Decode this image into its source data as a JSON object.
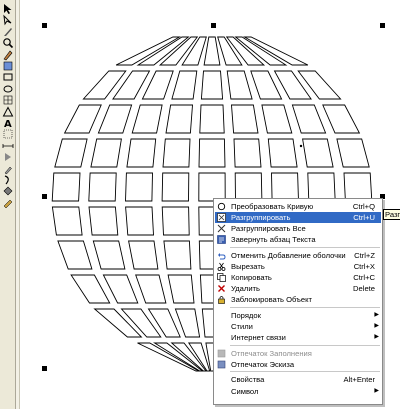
{
  "toolbox": {
    "tools": [
      "pick-tool",
      "shape-tool",
      "knife-tool",
      "zoom-tool",
      "freehand-tool",
      "smart-fill-tool",
      "rectangle-tool",
      "ellipse-tool",
      "polygon-tool",
      "basic-shapes-tool",
      "text-tool",
      "table-tool",
      "dimension-tool",
      "interactive-blend-tool",
      "eyedropper-tool",
      "outline-tool",
      "fill-tool",
      "interactive-fill-tool"
    ]
  },
  "drawing": {
    "object": "envelope-distorted-grid",
    "grid_rows": 10,
    "grid_cols": 9
  },
  "context_menu": {
    "items": [
      {
        "label": "Преобразовать Кривую",
        "shortcut": "Ctrl+Q",
        "icon": "convert-curve-icon",
        "enabled": true
      },
      {
        "label": "Разгруппировать",
        "shortcut": "Ctrl+U",
        "icon": "ungroup-icon",
        "enabled": true,
        "highlighted": true
      },
      {
        "label": "Разгруппировать Все",
        "shortcut": "",
        "icon": "ungroup-all-icon",
        "enabled": true
      },
      {
        "label": "Завернуть абзац Текста",
        "shortcut": "",
        "icon": "wrap-text-icon",
        "enabled": true
      },
      {
        "separator": true
      },
      {
        "label": "Отменить Добавление оболочки",
        "shortcut": "Ctrl+Z",
        "icon": "undo-icon",
        "enabled": true
      },
      {
        "label": "Вырезать",
        "shortcut": "Ctrl+X",
        "icon": "cut-icon",
        "enabled": true
      },
      {
        "label": "Копировать",
        "shortcut": "Ctrl+C",
        "icon": "copy-icon",
        "enabled": true
      },
      {
        "label": "Удалить",
        "shortcut": "Delete",
        "icon": "delete-icon",
        "enabled": true
      },
      {
        "label": "Заблокировать Объект",
        "shortcut": "",
        "icon": "lock-icon",
        "enabled": true
      },
      {
        "separator": true
      },
      {
        "label": "Порядок",
        "submenu": true,
        "enabled": true
      },
      {
        "label": "Стили",
        "submenu": true,
        "enabled": true
      },
      {
        "label": "Интернет связи",
        "submenu": true,
        "enabled": true
      },
      {
        "separator": true
      },
      {
        "label": "Отпечаток Заполнения",
        "shortcut": "",
        "icon": "fill-overprint-icon",
        "enabled": false
      },
      {
        "label": "Отпечаток Эскиза",
        "shortcut": "",
        "icon": "outline-overprint-icon",
        "enabled": true
      },
      {
        "separator": true
      },
      {
        "label": "Свойства",
        "shortcut": "Alt+Enter",
        "enabled": true
      },
      {
        "label": "Символ",
        "submenu": true,
        "enabled": true
      }
    ]
  },
  "tooltip": {
    "text": "Разгру"
  }
}
